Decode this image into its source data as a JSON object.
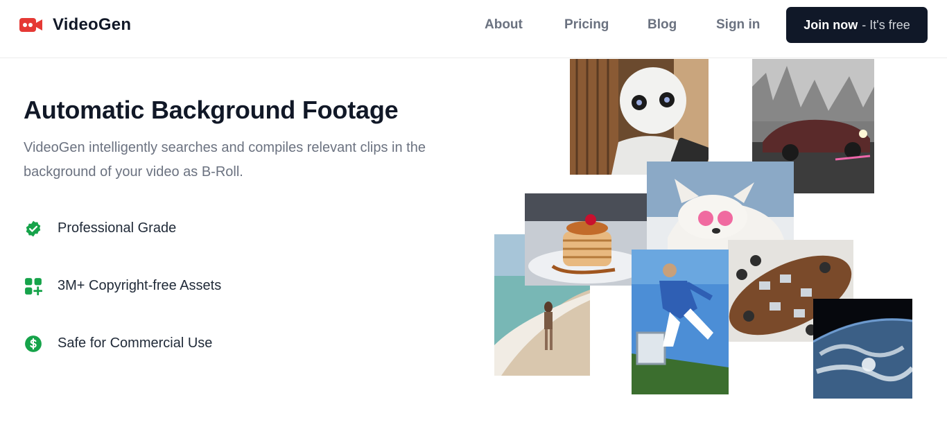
{
  "header": {
    "brand_name": "VideoGen",
    "nav": [
      {
        "label": "About"
      },
      {
        "label": "Pricing"
      },
      {
        "label": "Blog"
      },
      {
        "label": "Sign in"
      }
    ],
    "cta": {
      "primary": "Join now",
      "secondary": "- It's free"
    }
  },
  "hero": {
    "title": "Automatic Background Footage",
    "description": "VideoGen intelligently searches and compiles relevant clips in the background of your video as B-Roll.",
    "features": [
      {
        "label": "Professional Grade",
        "icon": "check-badge-icon"
      },
      {
        "label": "3M+ Copyright-free Assets",
        "icon": "grid-plus-icon"
      },
      {
        "label": "Safe for Commercial Use",
        "icon": "dollar-circle-icon"
      }
    ]
  },
  "colors": {
    "brand_red": "#e53935",
    "feature_green": "#16a34a",
    "cta_bg": "#101828",
    "nav_text": "#6b7280"
  },
  "collage": [
    {
      "name": "robot-photo"
    },
    {
      "name": "car-fog-photo"
    },
    {
      "name": "pancakes-photo"
    },
    {
      "name": "dog-sunglasses-photo"
    },
    {
      "name": "beach-walk-photo"
    },
    {
      "name": "jumping-person-photo"
    },
    {
      "name": "meeting-table-photo"
    },
    {
      "name": "earth-from-space-photo"
    }
  ]
}
